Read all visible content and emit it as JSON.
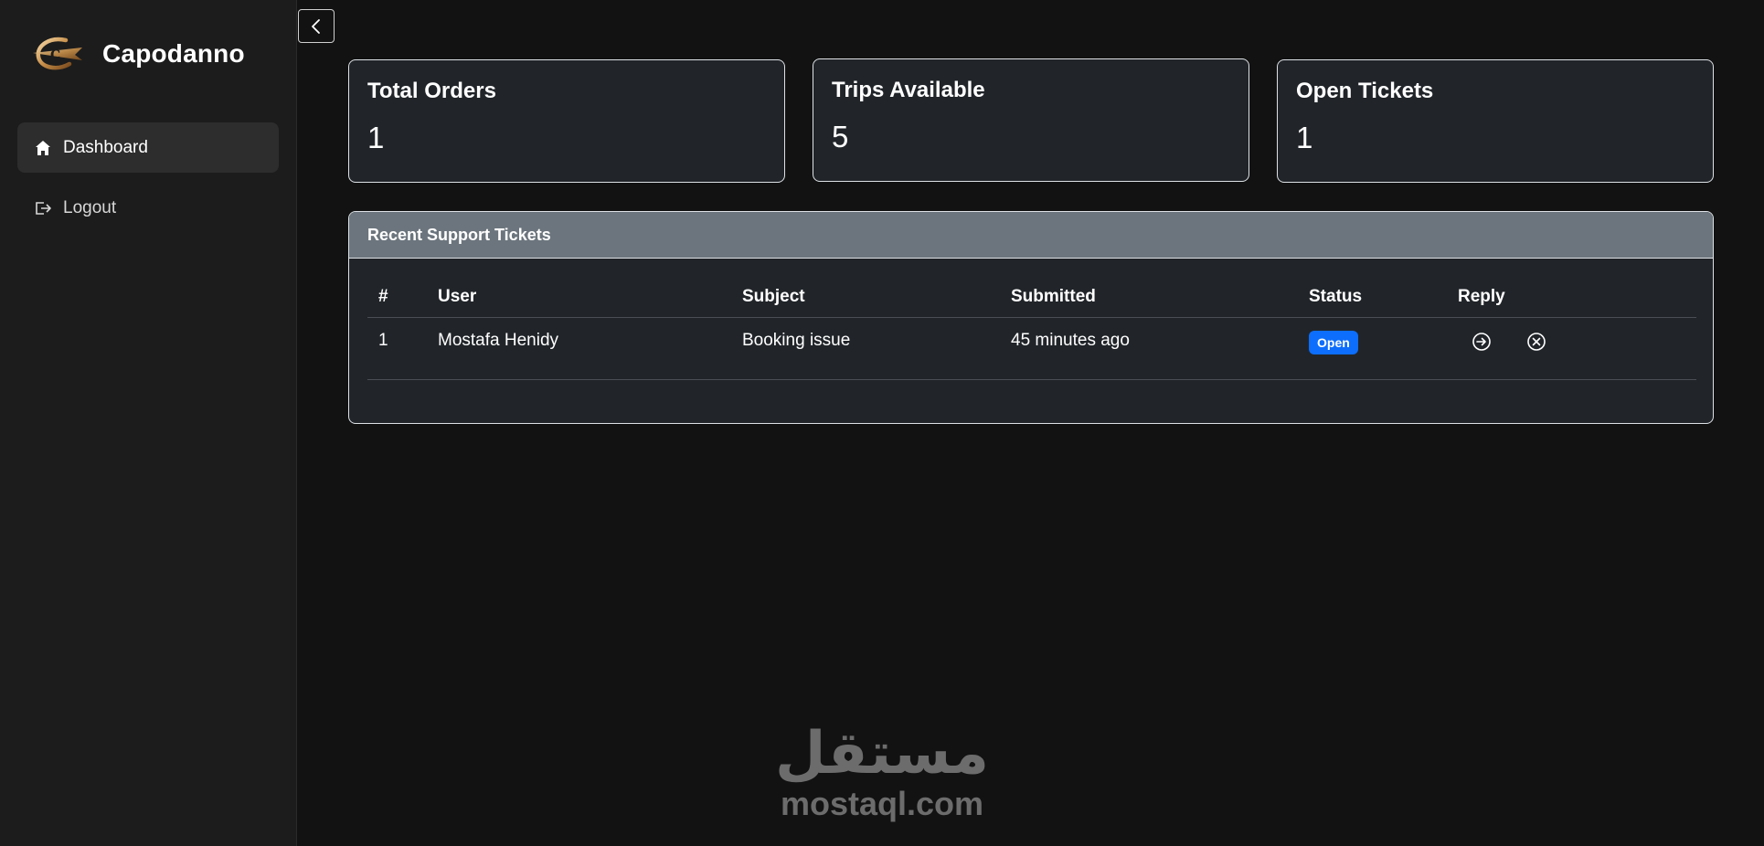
{
  "brand": {
    "name": "Capodanno",
    "logo_icon": "capodanno-logo"
  },
  "sidebar": {
    "items": [
      {
        "label": "Dashboard",
        "icon": "home-icon",
        "active": true
      },
      {
        "label": "Logout",
        "icon": "logout-icon",
        "active": false
      }
    ],
    "toggle_icon": "chevron-left-icon"
  },
  "stats": [
    {
      "title": "Total Orders",
      "value": "1"
    },
    {
      "title": "Trips Available",
      "value": "5"
    },
    {
      "title": "Open Tickets",
      "value": "1"
    }
  ],
  "tickets": {
    "title": "Recent Support Tickets",
    "columns": [
      "#",
      "User",
      "Subject",
      "Submitted",
      "Status",
      "Reply"
    ],
    "rows": [
      {
        "num": "1",
        "user": "Mostafa Henidy",
        "subject": "Booking issue",
        "submitted": "45 minutes ago",
        "status": "Open",
        "actions": [
          "reply-arrow-icon",
          "close-circle-icon"
        ]
      }
    ]
  },
  "watermark": {
    "arabic": "مستقل",
    "latin": "mostaql.com"
  },
  "colors": {
    "page_bg": "#121212",
    "sidebar_bg": "#1c1c1c",
    "card_bg": "#212529",
    "panel_header_bg": "#6c757d",
    "badge_bg": "#0d6efd"
  }
}
